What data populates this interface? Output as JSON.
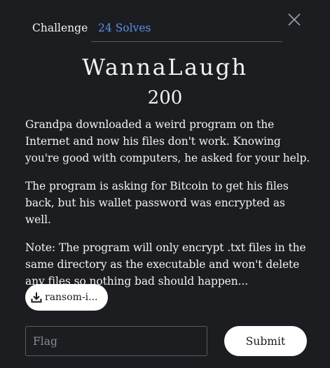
{
  "tabs": {
    "challenge_label": "Challenge",
    "solves_label": "24 Solves"
  },
  "challenge": {
    "name": "WannaLaugh",
    "points": "200",
    "description": [
      "Grandpa downloaded a weird program on the Internet and now his files don't work. Knowing you're good with computers, he asked for your help.",
      "The program is asking for Bitcoin to get his files back, but his wallet password was encrypted as well.",
      "Note: The program will only encrypt .txt files in the same directory as the executable and won't delete any files so nothing bad should happen..."
    ],
    "file_label": "ransom-i..."
  },
  "form": {
    "flag_placeholder": "Flag",
    "flag_value": "",
    "submit_label": "Submit"
  },
  "icons": {
    "close": "close-icon",
    "download": "download-icon"
  },
  "colors": {
    "background": "#1c1d21",
    "accent": "#5d8fe6",
    "text": "#f2f2f2"
  }
}
